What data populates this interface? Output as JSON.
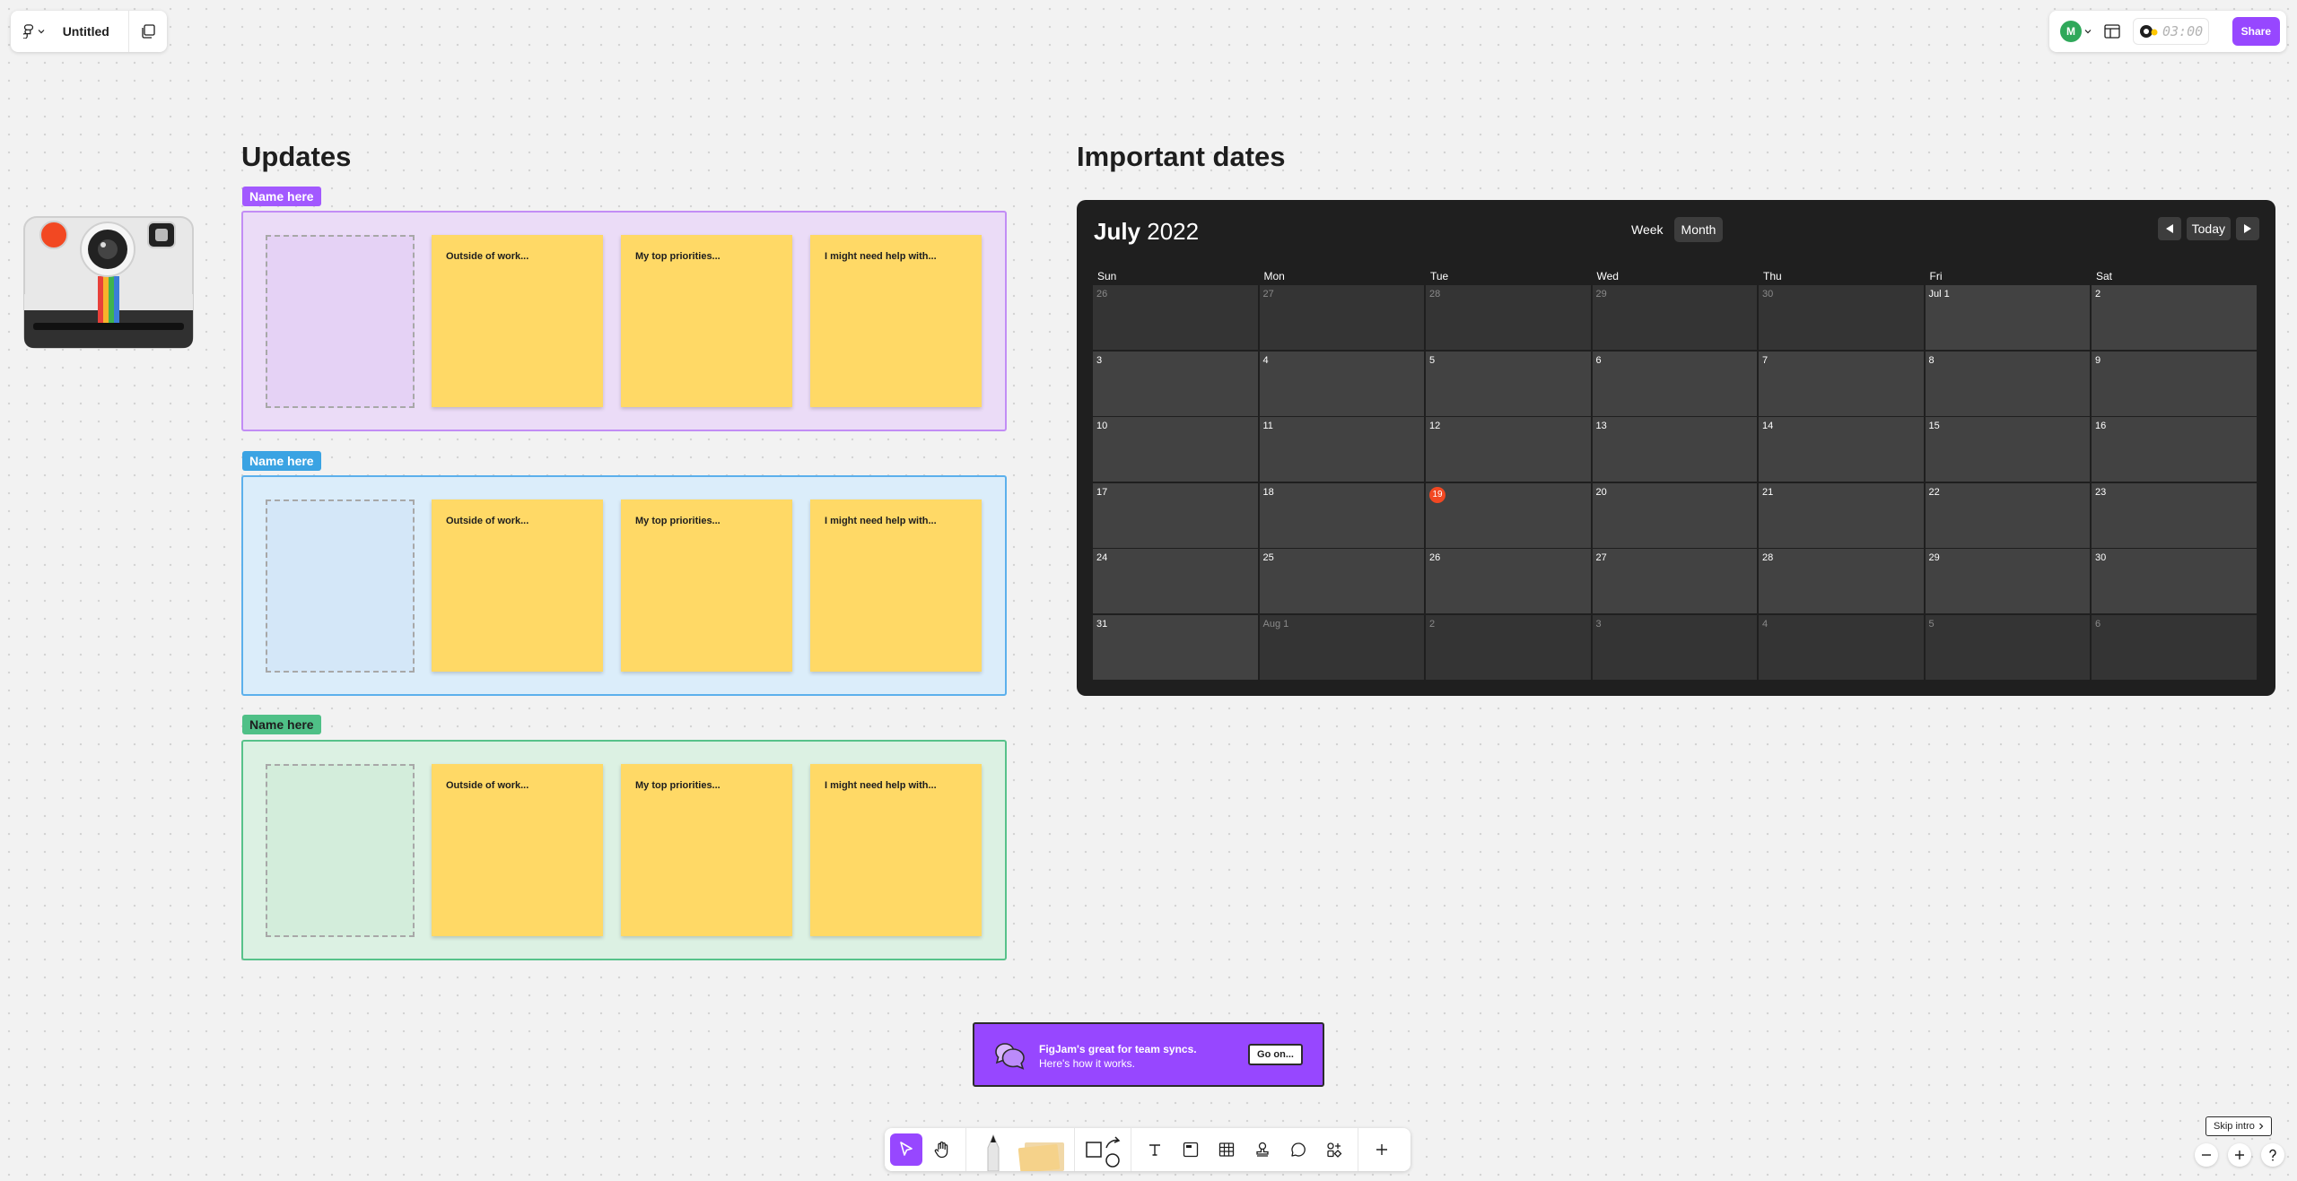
{
  "file": {
    "title": "Untitled"
  },
  "header": {
    "avatar_initial": "M",
    "timer": "03:00",
    "share_label": "Share"
  },
  "updates": {
    "heading": "Updates",
    "rows": [
      {
        "name_tag": "Name here",
        "tag_color": "#a259ff",
        "bg": "#ebdcf7",
        "border": "#c28df5",
        "slot_bg": "#e5d2f5",
        "notes": [
          "Outside of work...",
          "My top priorities...",
          "I might need help with..."
        ]
      },
      {
        "name_tag": "Name here",
        "tag_color": "#3aa3e3",
        "bg": "#dbedfa",
        "border": "#5cb0ec",
        "slot_bg": "#d4e7f8",
        "notes": [
          "Outside of work...",
          "My top priorities...",
          "I might need help with..."
        ]
      },
      {
        "name_tag": "Name here",
        "tag_color": "#4fc087",
        "bg": "#dcf1e3",
        "border": "#57c28a",
        "slot_bg": "#d3eddb",
        "notes": [
          "Outside of work...",
          "My top priorities...",
          "I might need help with..."
        ]
      }
    ]
  },
  "dates": {
    "heading": "Important dates",
    "calendar": {
      "month": "July",
      "year": "2022",
      "views": [
        "Week",
        "Month"
      ],
      "active_view": "Month",
      "today_label": "Today",
      "weekdays": [
        "Sun",
        "Mon",
        "Tue",
        "Wed",
        "Thu",
        "Fri",
        "Sat"
      ],
      "today": "19",
      "weeks": [
        [
          {
            "d": "26",
            "m": 1
          },
          {
            "d": "27",
            "m": 1
          },
          {
            "d": "28",
            "m": 1
          },
          {
            "d": "29",
            "m": 1
          },
          {
            "d": "30",
            "m": 1
          },
          {
            "d": "Jul 1",
            "m": 0
          },
          {
            "d": "2",
            "m": 0
          }
        ],
        [
          {
            "d": "3",
            "m": 0
          },
          {
            "d": "4",
            "m": 0
          },
          {
            "d": "5",
            "m": 0
          },
          {
            "d": "6",
            "m": 0
          },
          {
            "d": "7",
            "m": 0
          },
          {
            "d": "8",
            "m": 0
          },
          {
            "d": "9",
            "m": 0
          }
        ],
        [
          {
            "d": "10",
            "m": 0
          },
          {
            "d": "11",
            "m": 0
          },
          {
            "d": "12",
            "m": 0
          },
          {
            "d": "13",
            "m": 0
          },
          {
            "d": "14",
            "m": 0
          },
          {
            "d": "15",
            "m": 0
          },
          {
            "d": "16",
            "m": 0
          }
        ],
        [
          {
            "d": "17",
            "m": 0
          },
          {
            "d": "18",
            "m": 0
          },
          {
            "d": "19",
            "m": 0
          },
          {
            "d": "20",
            "m": 0
          },
          {
            "d": "21",
            "m": 0
          },
          {
            "d": "22",
            "m": 0
          },
          {
            "d": "23",
            "m": 0
          }
        ],
        [
          {
            "d": "24",
            "m": 0
          },
          {
            "d": "25",
            "m": 0
          },
          {
            "d": "26",
            "m": 0
          },
          {
            "d": "27",
            "m": 0
          },
          {
            "d": "28",
            "m": 0
          },
          {
            "d": "29",
            "m": 0
          },
          {
            "d": "30",
            "m": 0
          }
        ],
        [
          {
            "d": "31",
            "m": 0
          },
          {
            "d": "Aug 1",
            "m": 1
          },
          {
            "d": "2",
            "m": 1
          },
          {
            "d": "3",
            "m": 1
          },
          {
            "d": "4",
            "m": 1
          },
          {
            "d": "5",
            "m": 1
          },
          {
            "d": "6",
            "m": 1
          }
        ]
      ]
    }
  },
  "banner": {
    "line1": "FigJam's great for team syncs.",
    "line2": "Here's how it works.",
    "button": "Go on..."
  },
  "skip_intro": "Skip intro",
  "colors": {
    "accent": "#9747ff",
    "today_badge": "#f24822",
    "sticky": "#ffd966"
  }
}
